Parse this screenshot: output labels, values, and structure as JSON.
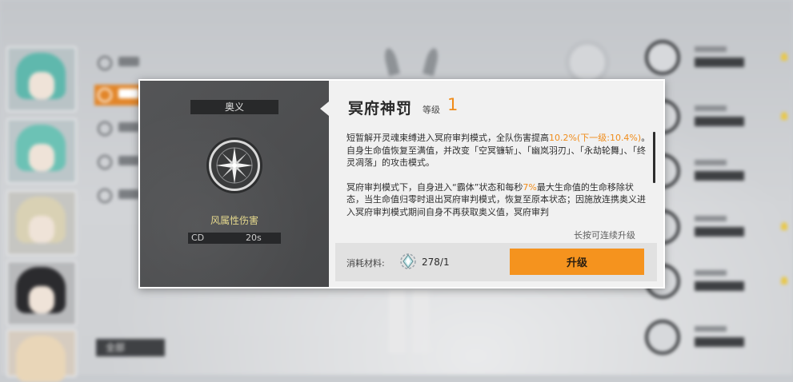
{
  "panel": {
    "type_label": "奥义",
    "damage_type": "风属性伤害",
    "cd_label": "CD",
    "cd_value": "20s",
    "skill_title": "冥府神罚",
    "level_label": "等级",
    "level_value": "1",
    "desc_p1_a": "短暂解开灵魂束缚进入冥府审判模式，全队伤害提高",
    "desc_p1_hl": "10.2%(下一级:10.4%)",
    "desc_p1_b": "。自身生命值恢复至满值，并改变「空冥镰斩」、「幽岚羽刃」、「永劫轮舞」、「终灵凋落」的攻击模式。",
    "desc_p2_a": "冥府审判模式下，自身进入“霸体”状态和每秒",
    "desc_p2_hl": "7%",
    "desc_p2_b": "最大生命值的生命移除状态，当生命值归零时退出冥府审判模式，恢复至原本状态；因施放连携奥义进入冥府审判模式期间自身不再获取奥义值，冥府审判",
    "hold_hint": "长按可连续升级",
    "cost_label": "消耗材料:",
    "cost_value": "278/1",
    "upgrade_button": "升级"
  },
  "background": {
    "filter_button": "全部"
  },
  "colors": {
    "accent_orange": "#f5931e",
    "level_orange": "#f08c1a",
    "damage_yellow": "#e6d98d"
  },
  "icons": {
    "skill": "compass-star-icon",
    "material": "crystal-icon"
  }
}
